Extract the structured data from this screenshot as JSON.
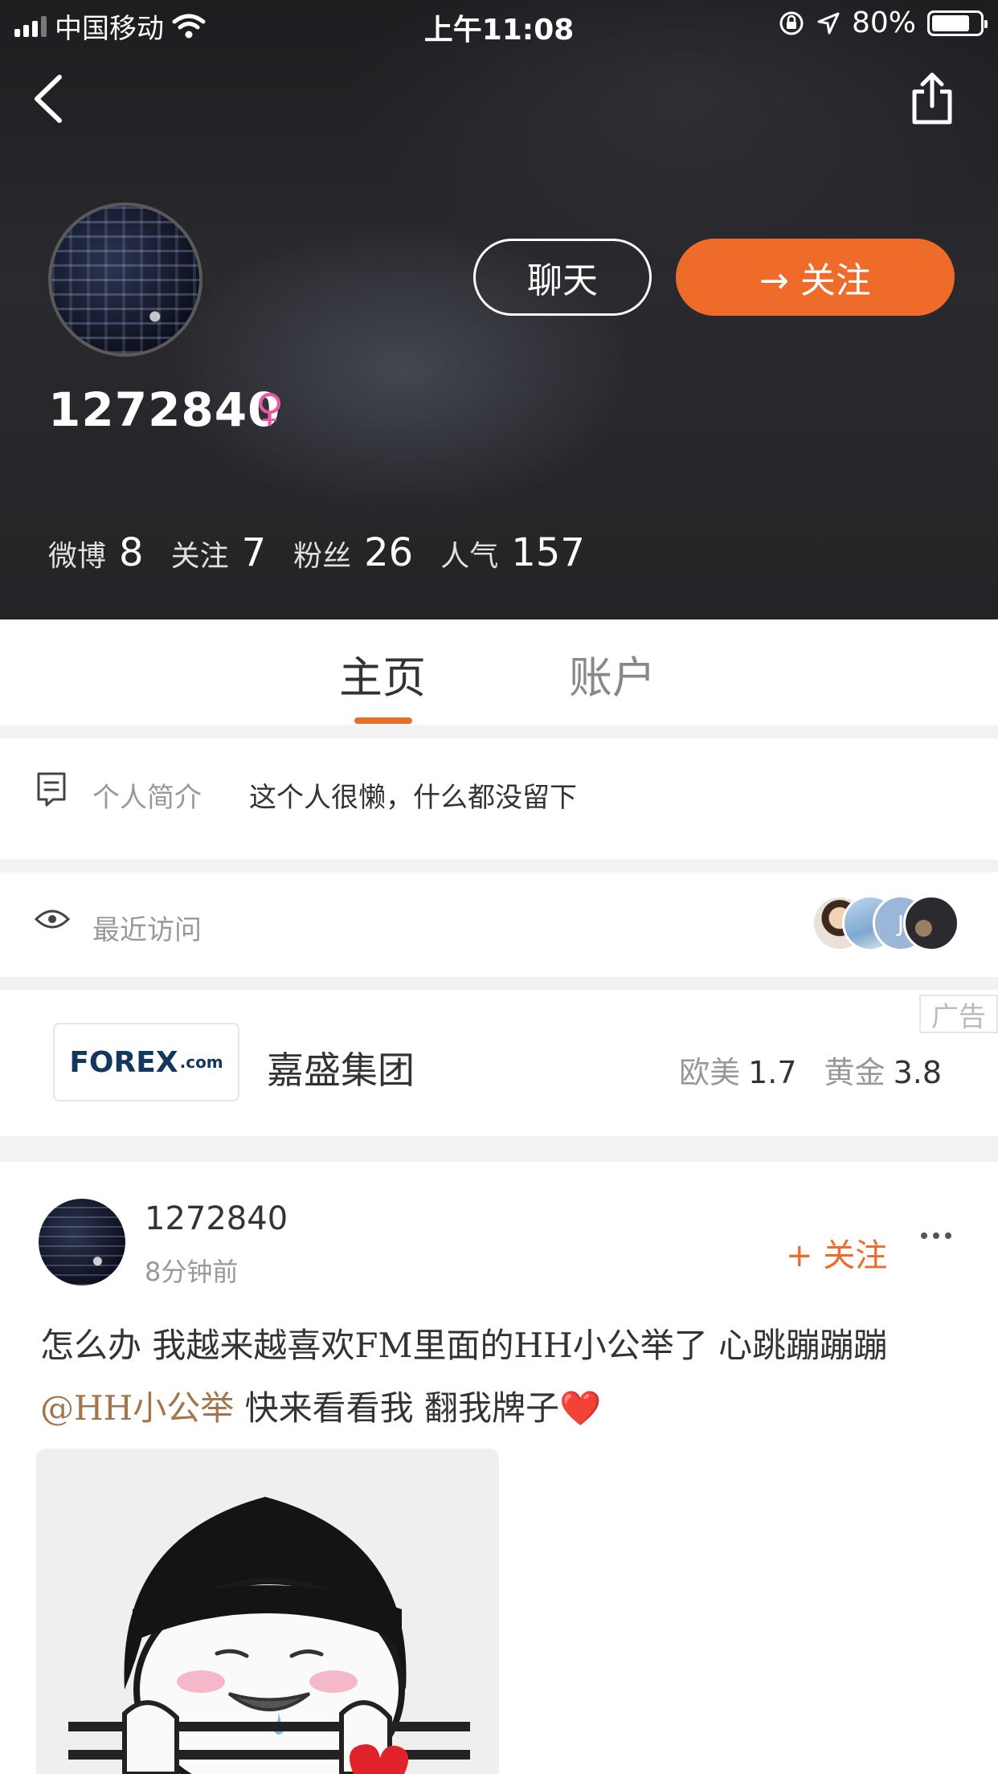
{
  "status_bar": {
    "carrier": "中国移动",
    "time": "上午11:08",
    "battery": "80%",
    "battery_level": 0.8
  },
  "profile": {
    "name": "1272840",
    "gender_symbol": "♀",
    "chat_label": "聊天",
    "follow_label": "→ 关注",
    "stats": [
      {
        "label": "微博",
        "value": "8"
      },
      {
        "label": "关注",
        "value": "7"
      },
      {
        "label": "粉丝",
        "value": "26"
      },
      {
        "label": "人气",
        "value": "157"
      }
    ]
  },
  "tabs": [
    {
      "label": "主页",
      "active": true
    },
    {
      "label": "账户",
      "active": false
    }
  ],
  "bio": {
    "label": "个人简介",
    "text": "这个人很懒，什么都没留下"
  },
  "recent": {
    "label": "最近访问",
    "visitor_initial": "J"
  },
  "ad": {
    "logo_text": "FOREX",
    "logo_suffix": ".com",
    "name": "嘉盛集团",
    "rates": [
      {
        "label": "欧美",
        "value": "1.7"
      },
      {
        "label": "黄金",
        "value": "3.8"
      }
    ],
    "tag": "广告"
  },
  "post": {
    "author": "1272840",
    "time": "8分钟前",
    "follow_label": "+ 关注",
    "text_line1": "怎么办 我越来越喜欢FM里面的HH小公举了 心跳蹦蹦蹦",
    "mention": "@HH小公举",
    "text_line2_rest": " 快来看看我 翻我牌子",
    "emoji": "❤️"
  },
  "colors": {
    "accent": "#ef6b2a",
    "mention": "#a4754a",
    "gender": "#e55aa8"
  }
}
